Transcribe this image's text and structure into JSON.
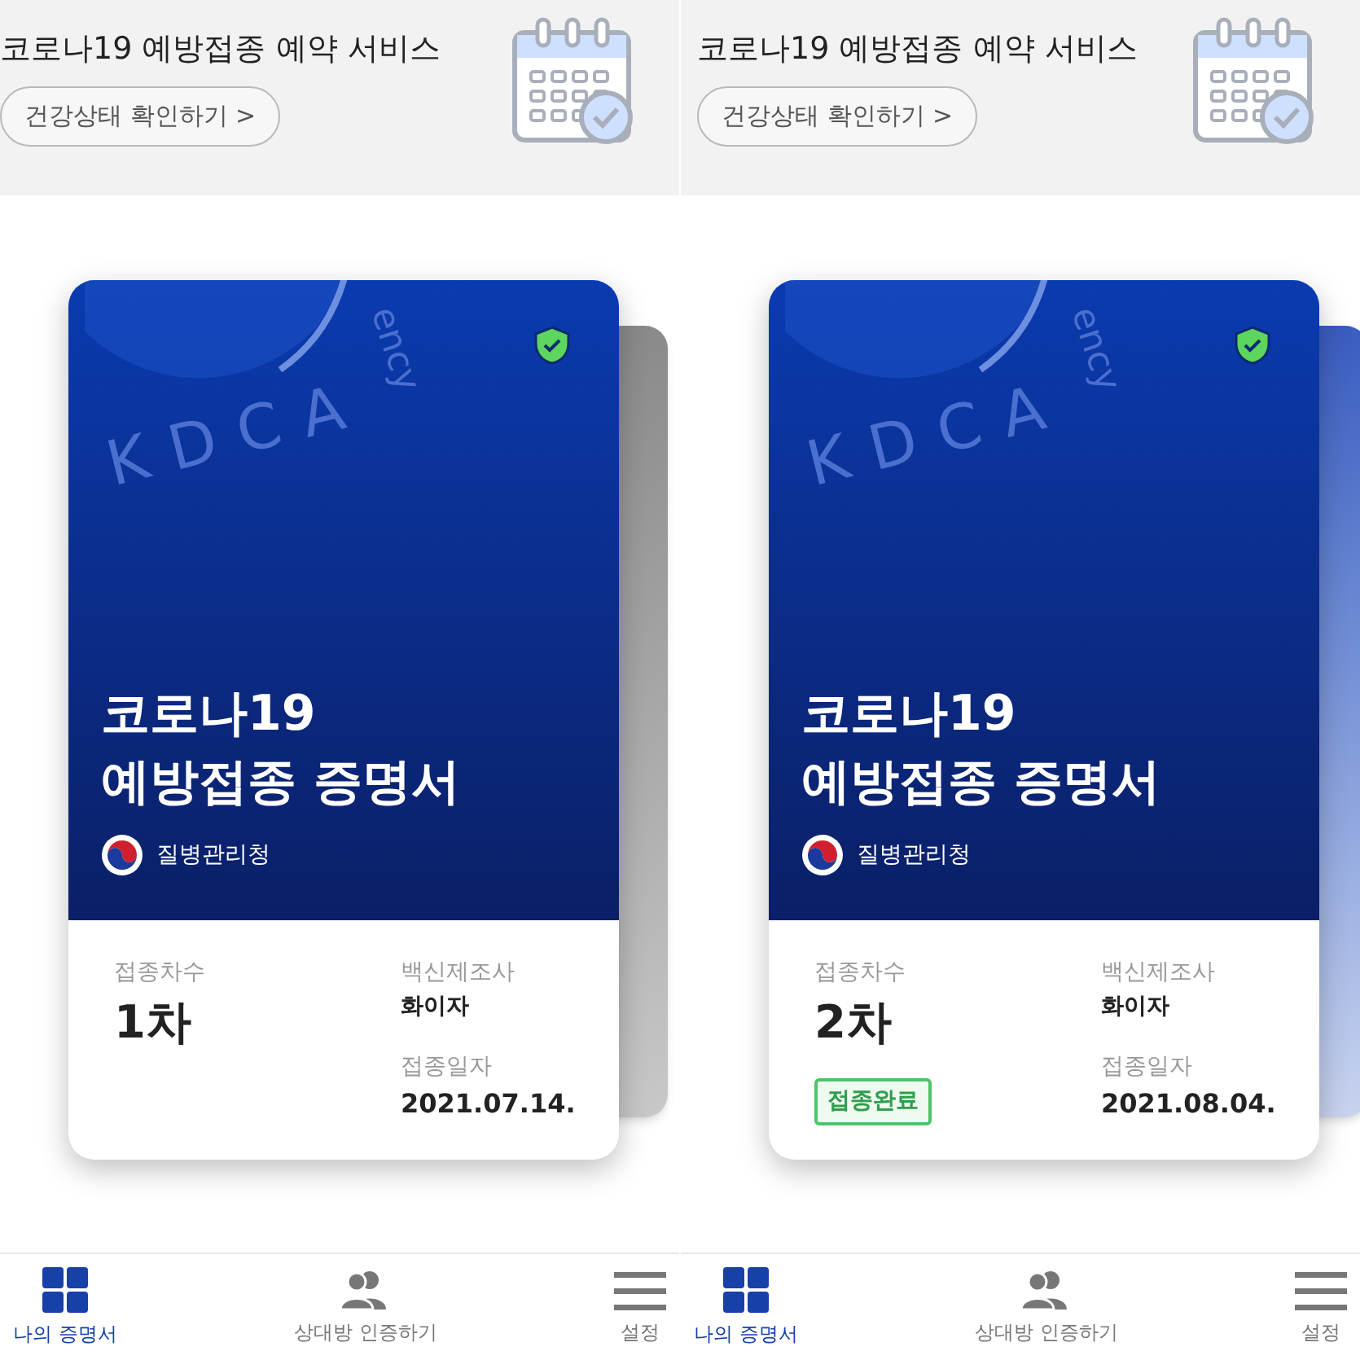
{
  "panels": [
    {
      "header": {
        "title": "코로나19 예방접종 예약 서비스",
        "button": "건강상태 확인하기 >"
      },
      "card": {
        "emblem": "KDCA",
        "emblem_arc": "ency",
        "verified": true,
        "title_lines": [
          "코로나19",
          "예방접종 증명서"
        ],
        "agency": "질병관리청",
        "dose_label": "접종차수",
        "dose": "1차",
        "maker_label": "백신제조사",
        "maker": "화이자",
        "date_label": "접종일자",
        "date": "2021.07.14."
      },
      "back_card": {
        "kind": "gray"
      },
      "nav": [
        {
          "label": "나의 증명서",
          "kind": "grid",
          "selected": true
        },
        {
          "label": "상대방 인증하기",
          "kind": "people",
          "selected": false
        },
        {
          "label": "설정",
          "kind": "menu",
          "selected": false
        }
      ]
    },
    {
      "header": {
        "title": "코로나19 예방접종 예약 서비스",
        "button": "건강상태 확인하기 >"
      },
      "card": {
        "emblem": "KDCA",
        "emblem_arc": "ency",
        "verified": true,
        "title_lines": [
          "코로나19",
          "예방접종 증명서"
        ],
        "agency": "질병관리청",
        "dose_label": "접종차수",
        "dose": "2차",
        "badge": "접종완료",
        "maker_label": "백신제조사",
        "maker": "화이자",
        "date_label": "접종일자",
        "date": "2021.08.04."
      },
      "back_card": {
        "kind": "blue"
      },
      "nav": [
        {
          "label": "나의 증명서",
          "kind": "grid",
          "selected": true
        },
        {
          "label": "상대방 인증하기",
          "kind": "people",
          "selected": false
        },
        {
          "label": "설정",
          "kind": "menu",
          "selected": false
        }
      ]
    }
  ]
}
